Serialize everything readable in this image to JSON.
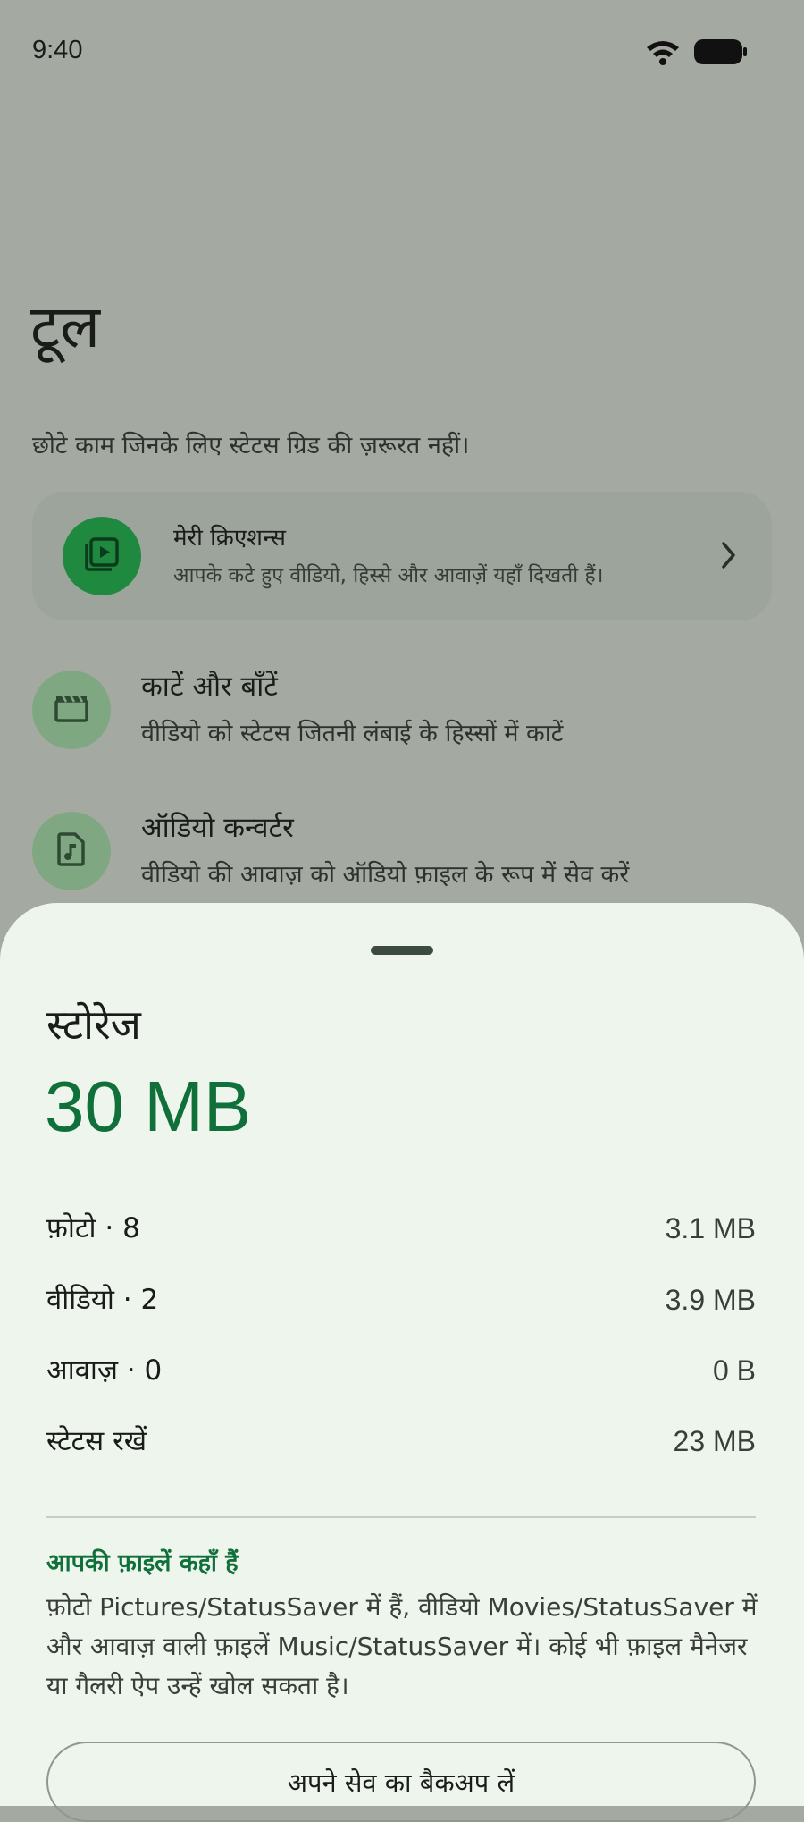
{
  "status_bar": {
    "time": "9:40",
    "icons": [
      "wifi-icon",
      "battery-icon"
    ]
  },
  "page": {
    "title": "टूल",
    "subtitle": "छोटे काम जिनके लिए स्टेटस ग्रिड की ज़रूरत नहीं।"
  },
  "creations": {
    "title": "मेरी क्रिएशन्स",
    "description": "आपके कटे हुए वीडियो, हिस्से और आवाज़ें यहाँ दिखती हैं।",
    "icon": "video-library-icon"
  },
  "tools": [
    {
      "title": "काटें और बाँटें",
      "description": "वीडियो को स्टेटस जितनी लंबाई के हिस्सों में काटें",
      "icon": "clapperboard-icon"
    },
    {
      "title": "ऑडियो कन्वर्टर",
      "description": "वीडियो की आवाज़ को ऑडियो फ़ाइल के रूप में सेव करें",
      "icon": "audio-file-icon"
    }
  ],
  "sheet": {
    "title": "स्टोरेज",
    "total": "30 MB",
    "rows": [
      {
        "label": "फ़ोटो · 8",
        "value": "3.1 MB"
      },
      {
        "label": "वीडियो · 2",
        "value": "3.9 MB"
      },
      {
        "label": "आवाज़ · 0",
        "value": "0 B"
      },
      {
        "label": "स्टेटस रखें",
        "value": "23 MB"
      }
    ],
    "files_heading": "आपकी फ़ाइलें कहाँ हैं",
    "files_body": "फ़ोटो Pictures/StatusSaver में हैं, वीडियो Movies/StatusSaver में और आवाज़ वाली फ़ाइलें Music/StatusSaver में। कोई भी फ़ाइल मैनेजर या गैलरी ऐप उन्हें खोल सकता है।",
    "backup_button": "अपने सेव का बैकअप लें"
  },
  "colors": {
    "accent": "#10703a",
    "accent_strong": "#1f8a3f",
    "scrim_background": "#a4aaa2",
    "sheet_background": "#eef5ec"
  }
}
